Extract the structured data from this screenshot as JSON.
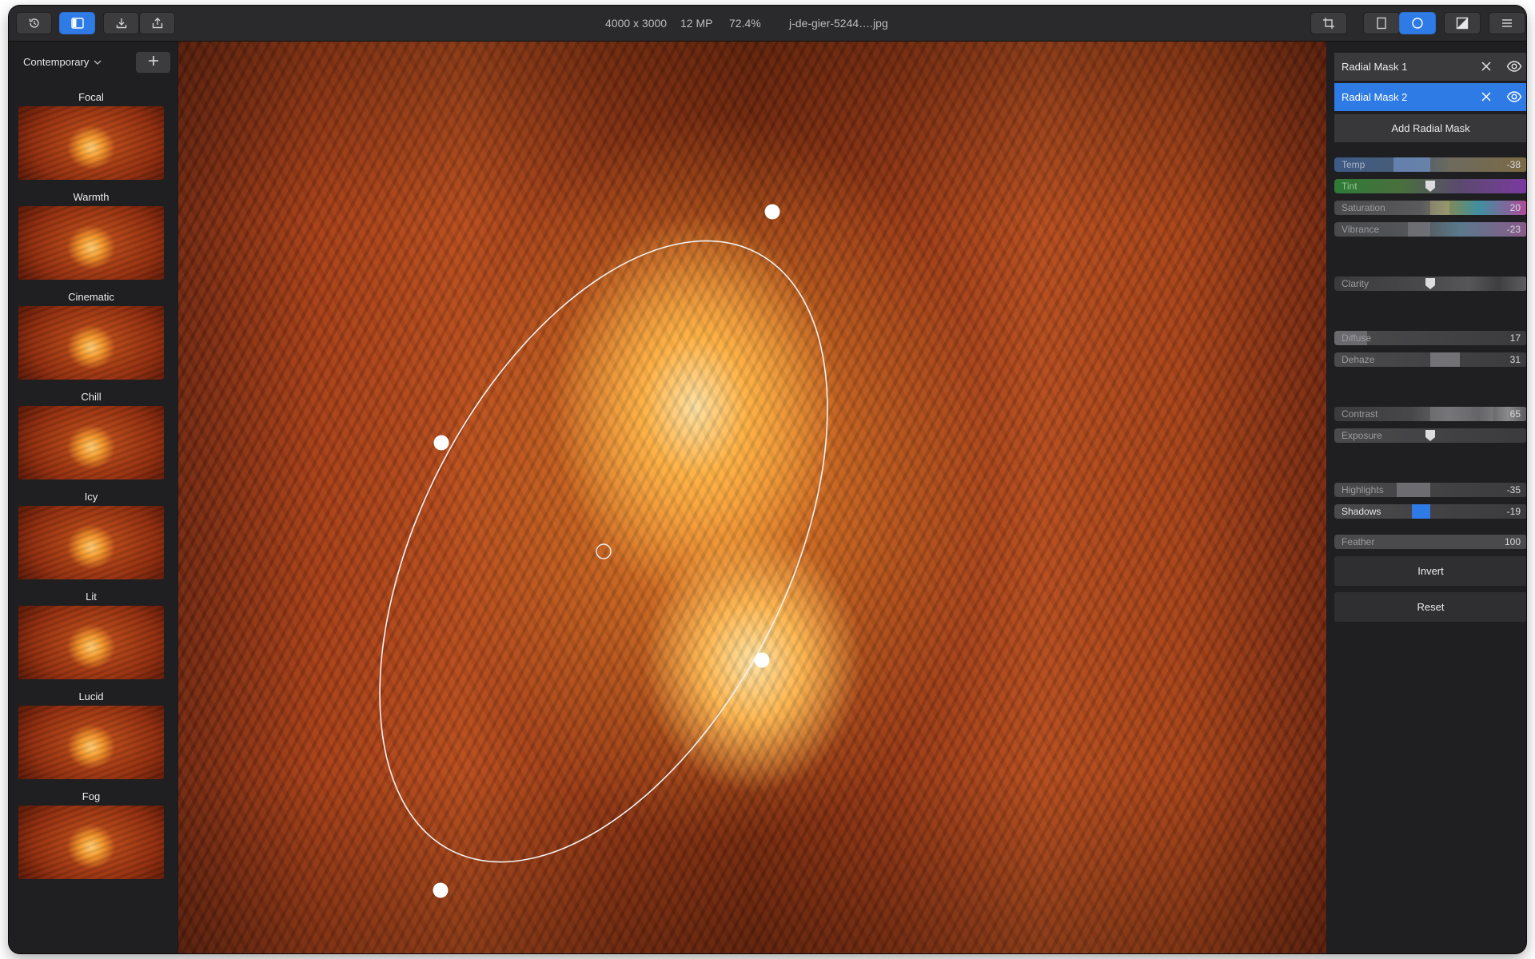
{
  "toolbar": {
    "image_size": "4000 x 3000",
    "megapixels": "12 MP",
    "zoom": "72.4%",
    "filename": "j-de-gier-5244….jpg",
    "accent_color": "#2f7be6"
  },
  "presets": {
    "category": "Contemporary",
    "items": [
      {
        "label": "Focal"
      },
      {
        "label": "Warmth"
      },
      {
        "label": "Cinematic"
      },
      {
        "label": "Chill"
      },
      {
        "label": "Icy"
      },
      {
        "label": "Lit"
      },
      {
        "label": "Lucid"
      },
      {
        "label": "Fog"
      }
    ]
  },
  "masks": {
    "items": [
      {
        "label": "Radial Mask 1",
        "active": false
      },
      {
        "label": "Radial Mask 2",
        "active": true
      }
    ],
    "add_label": "Add Radial Mask"
  },
  "adjustments": {
    "temp": {
      "label": "Temp",
      "value": "-38"
    },
    "tint": {
      "label": "Tint",
      "value": ""
    },
    "saturation": {
      "label": "Saturation",
      "value": "20"
    },
    "vibrance": {
      "label": "Vibrance",
      "value": "-23"
    },
    "clarity": {
      "label": "Clarity",
      "value": ""
    },
    "diffuse": {
      "label": "Diffuse",
      "value": "17"
    },
    "dehaze": {
      "label": "Dehaze",
      "value": "31"
    },
    "contrast": {
      "label": "Contrast",
      "value": "65"
    },
    "exposure": {
      "label": "Exposure",
      "value": ""
    },
    "highlights": {
      "label": "Highlights",
      "value": "-35"
    },
    "shadows": {
      "label": "Shadows",
      "value": "-19"
    },
    "feather": {
      "label": "Feather",
      "value": "100"
    }
  },
  "actions": {
    "invert": "Invert",
    "reset": "Reset"
  }
}
